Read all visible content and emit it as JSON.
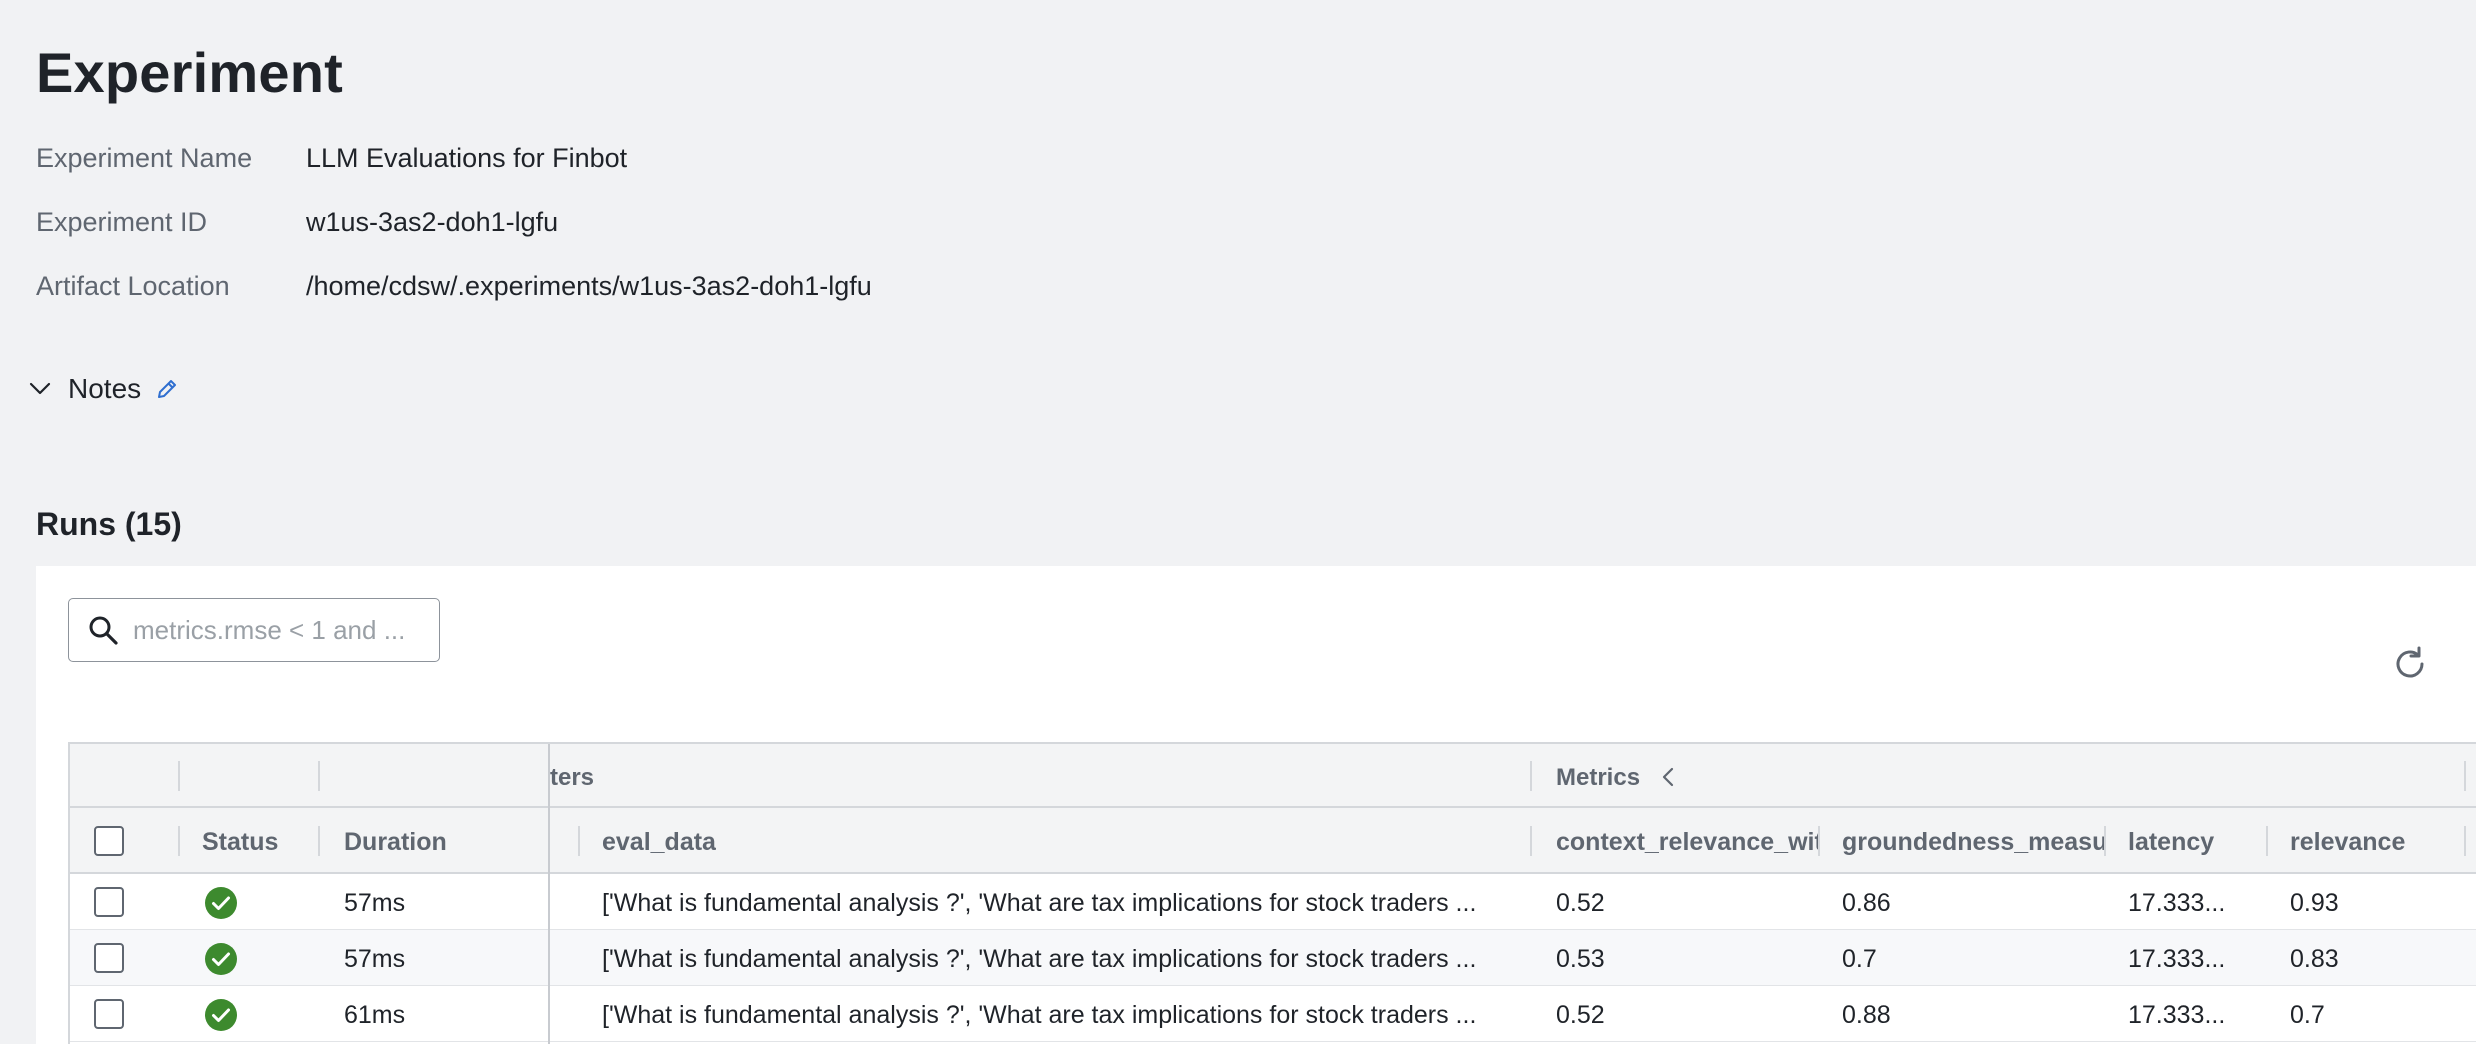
{
  "page": {
    "title": "Experiment"
  },
  "details": {
    "name_label": "Experiment Name",
    "name_value": "LLM Evaluations for Finbot",
    "id_label": "Experiment ID",
    "id_value": "w1us-3as2-doh1-lgfu",
    "artifact_label": "Artifact Location",
    "artifact_value": "/home/cdsw/.experiments/w1us-3as2-doh1-lgfu"
  },
  "notes": {
    "label": "Notes",
    "icons": [
      "chevron-down-icon",
      "pencil-icon"
    ]
  },
  "runs": {
    "title": "Runs (15)",
    "search": {
      "placeholder": "metrics.rmse < 1 and ...",
      "icon": "search-icon"
    },
    "refresh_icon": "refresh-icon",
    "table": {
      "groups": {
        "params": "ters",
        "metrics": "Metrics"
      },
      "columns": {
        "status": "Status",
        "duration": "Duration",
        "eval_data": "eval_data",
        "context_relevance": "context_relevance_wit",
        "groundedness": "groundedness_measu",
        "latency": "latency",
        "relevance": "relevance"
      },
      "rows": [
        {
          "status": "success",
          "duration": "57ms",
          "eval_data": "['What is fundamental analysis ?', 'What are tax implications for stock traders ...",
          "context_relevance": "0.52",
          "groundedness": "0.86",
          "latency": "17.333...",
          "relevance": "0.93"
        },
        {
          "status": "success",
          "duration": "57ms",
          "eval_data": "['What is fundamental analysis ?', 'What are tax implications for stock traders ...",
          "context_relevance": "0.53",
          "groundedness": "0.7",
          "latency": "17.333...",
          "relevance": "0.83"
        },
        {
          "status": "success",
          "duration": "61ms",
          "eval_data": "['What is fundamental analysis ?', 'What are tax implications for stock traders ...",
          "context_relevance": "0.52",
          "groundedness": "0.88",
          "latency": "17.333...",
          "relevance": "0.7"
        }
      ]
    }
  },
  "colors": {
    "success": "#3d8a2e",
    "accent": "#2f6fd0",
    "background": "#f1f2f4"
  }
}
